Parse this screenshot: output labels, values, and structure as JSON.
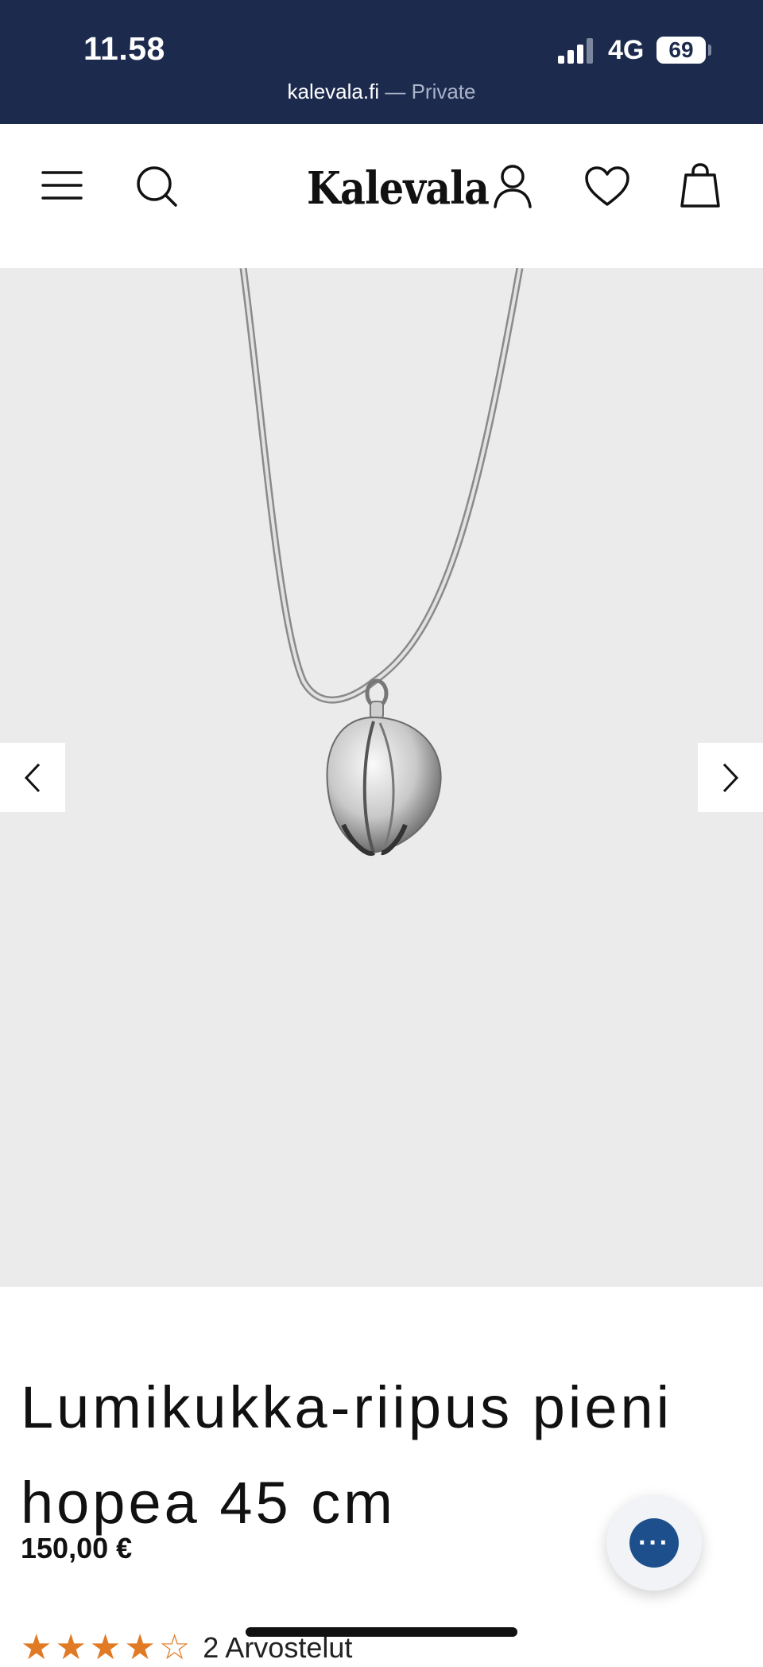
{
  "status_bar": {
    "time": "11.58",
    "network": "4G",
    "battery": "69",
    "domain": "kalevala.fi",
    "mode": "— Private"
  },
  "header": {
    "logo": "Kalevala",
    "icons": [
      "menu-icon",
      "search-icon",
      "account-icon",
      "wishlist-heart-icon",
      "shopping-bag-icon"
    ]
  },
  "gallery": {
    "prev_label": "‹",
    "next_label": "›",
    "image_subject": "Silver snowdrop pendant on snake chain"
  },
  "product": {
    "title": "Lumikukka-riipus pieni hopea 45 cm",
    "price": "150,00 €",
    "rating_stars": 4.5,
    "rating_max": 5,
    "reviews_text": "2 Arvostelut"
  },
  "chat": {
    "dots": "···"
  },
  "colors": {
    "status_bg": "#1c2a4d",
    "gallery_bg": "#ebebeb",
    "star": "#e07a25",
    "chat": "#1d4f8c"
  }
}
